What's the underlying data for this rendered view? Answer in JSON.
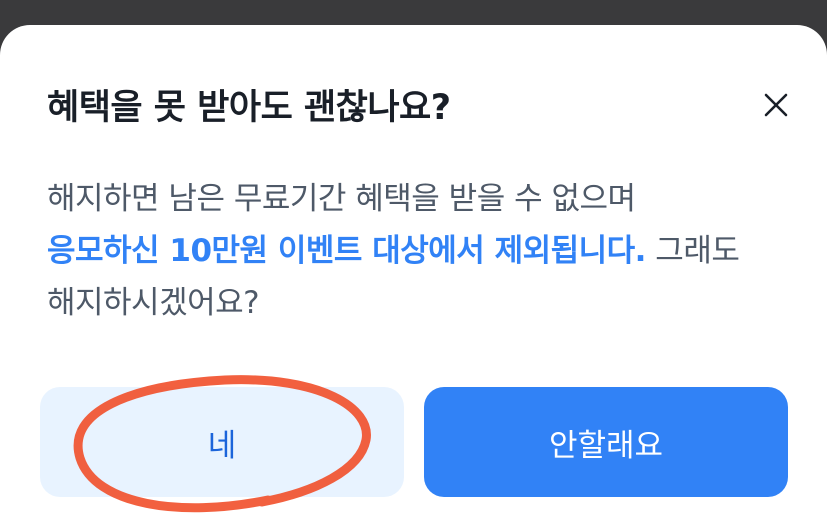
{
  "dialog": {
    "title": "혜택을 못 받아도 괜찮나요?",
    "close_icon": "close-icon",
    "description": {
      "line1": "해지하면 남은 무료기간 혜택을 받을 수 없으며",
      "highlight": "응모하신 10만원 이벤트 대상에서 제외됩니다.",
      "after_highlight": " 그래도",
      "line3": "해지하시겠어요?"
    },
    "buttons": {
      "yes_label": "네",
      "no_label": "안할래요"
    }
  },
  "colors": {
    "accent": "#3182f6",
    "secondary_button_bg": "#e8f3ff",
    "annotation": "#f04a24"
  }
}
